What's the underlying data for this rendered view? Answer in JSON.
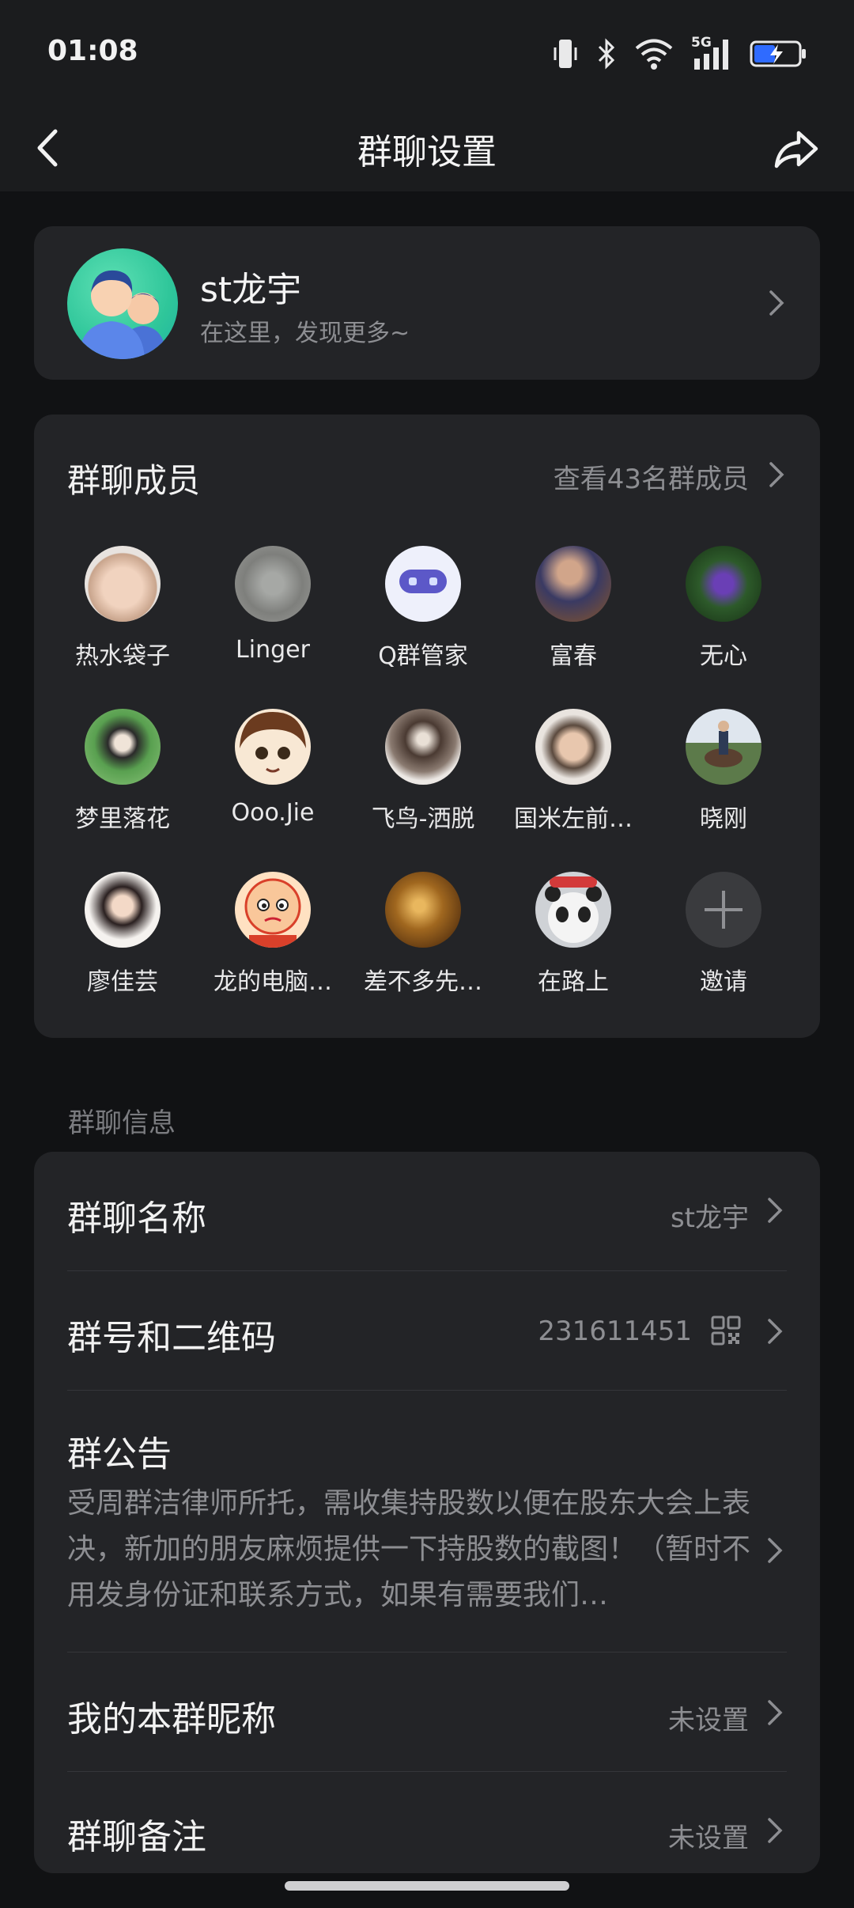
{
  "status_bar": {
    "time": "01:08",
    "network": "5G"
  },
  "nav": {
    "title": "群聊设置"
  },
  "profile": {
    "name": "st龙宇",
    "subtitle": "在这里，发现更多~"
  },
  "members": {
    "title": "群聊成员",
    "link": "查看43名群成员",
    "list": [
      {
        "name": "热水袋子"
      },
      {
        "name": "Linger"
      },
      {
        "name": "Q群管家"
      },
      {
        "name": "富春"
      },
      {
        "name": "无心"
      },
      {
        "name": "梦里落花"
      },
      {
        "name": "Ooo.Jie"
      },
      {
        "name": "飞鸟-洒脱"
      },
      {
        "name": "国米左前…"
      },
      {
        "name": "晓刚"
      },
      {
        "name": "廖佳芸"
      },
      {
        "name": "龙的电脑…"
      },
      {
        "name": "差不多先…"
      },
      {
        "name": "在路上"
      }
    ],
    "invite_label": "邀请"
  },
  "info": {
    "section_label": "群聊信息",
    "group_name_label": "群聊名称",
    "group_name_value": "st龙宇",
    "group_id_label": "群号和二维码",
    "group_id_value": "231611451",
    "notice_label": "群公告",
    "notice_text": "受周群洁律师所托，需收集持股数以便在股东大会上表决，新加的朋友麻烦提供一下持股数的截图！（暂时不用发身份证和联系方式，如果有需要我们…",
    "nickname_label": "我的本群昵称",
    "nickname_value": "未设置",
    "remark_label": "群聊备注",
    "remark_value": "未设置"
  }
}
